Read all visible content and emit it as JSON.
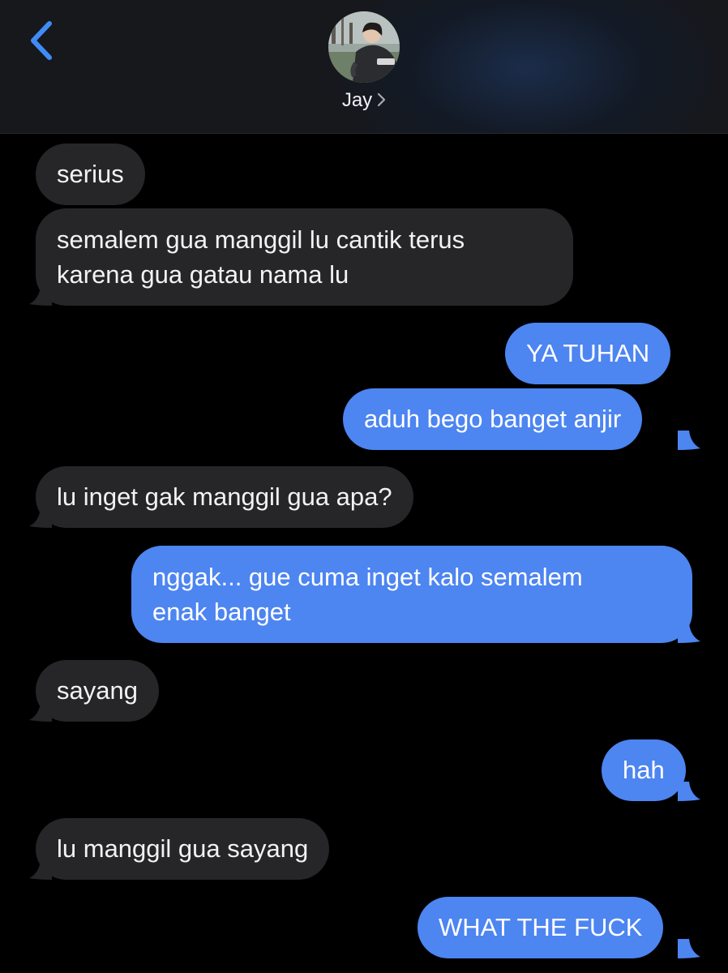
{
  "header": {
    "contact_name": "Jay",
    "back_icon": "chevron-left-icon",
    "accent_color": "#3f8cf7"
  },
  "colors": {
    "incoming_bubble": "#262629",
    "outgoing_bubble": "#4d85f1",
    "background": "#000000"
  },
  "messages": [
    {
      "direction": "incoming",
      "lines": [
        "serius"
      ]
    },
    {
      "direction": "incoming",
      "lines": [
        "semalem gua manggil lu cantik terus",
        "karena gua gatau nama lu"
      ]
    },
    {
      "direction": "outgoing",
      "lines": [
        "YA TUHAN"
      ]
    },
    {
      "direction": "outgoing",
      "lines": [
        "aduh bego banget anjir"
      ]
    },
    {
      "direction": "incoming",
      "lines": [
        "lu inget gak manggil gua apa?"
      ]
    },
    {
      "direction": "outgoing",
      "lines": [
        "nggak... gue cuma inget kalo semalem",
        "enak banget"
      ]
    },
    {
      "direction": "incoming",
      "lines": [
        "sayang"
      ]
    },
    {
      "direction": "outgoing",
      "lines": [
        "hah"
      ]
    },
    {
      "direction": "incoming",
      "lines": [
        "lu manggil gua sayang"
      ]
    },
    {
      "direction": "outgoing",
      "lines": [
        "WHAT THE FUCK"
      ]
    }
  ]
}
